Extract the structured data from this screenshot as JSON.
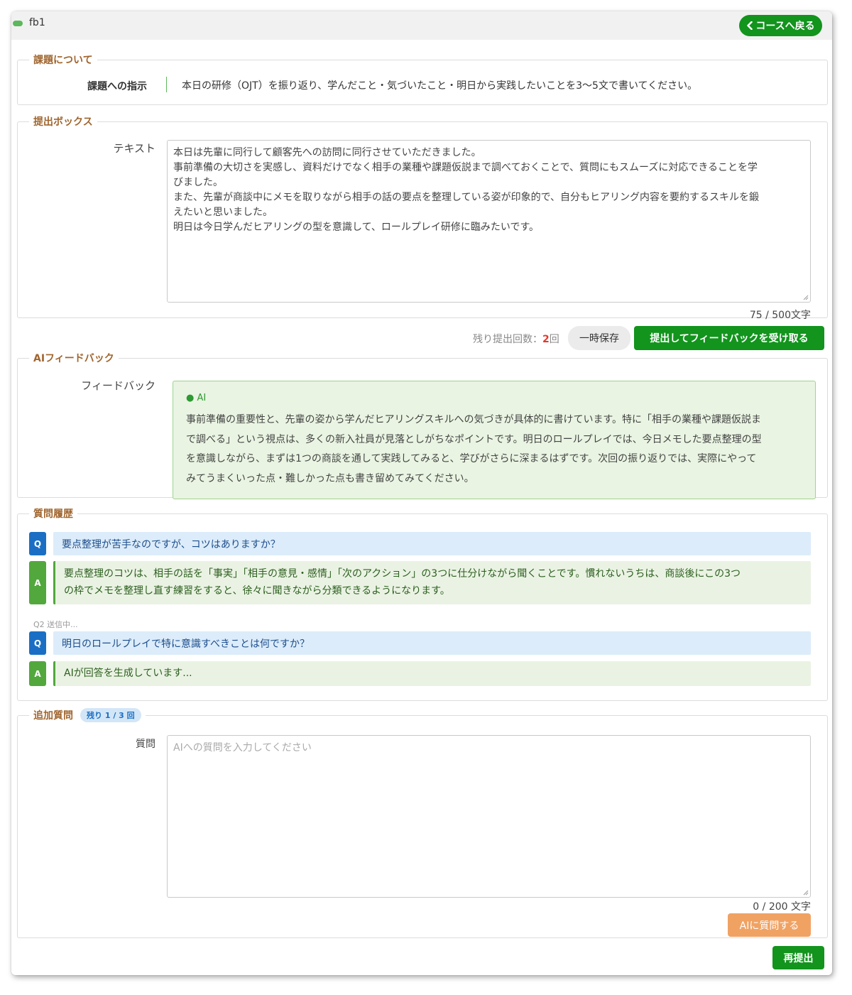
{
  "header": {
    "title": "fb1",
    "back_button": "コースへ戻る"
  },
  "assignment": {
    "legend": "課題について",
    "instruction_label": "課題への指示",
    "instruction_text": "本日の研修（OJT）を振り返り、学んだこと・気づいたこと・明日から実践したいことを3〜5文で書いてください。"
  },
  "submission": {
    "legend": "提出ボックス",
    "text_label": "テキスト",
    "lines": [
      "本日は先輩に同行して顧客先への訪問に同行させていただきました。",
      "事前準備の大切さを実感し、資料だけでなく相手の業種や課題仮説まで調べておくことで、質問にもスムーズに対応できることを学",
      "びました。",
      "また、先輩が商談中にメモを取りながら相手の話の要点を整理している姿が印象的で、自分もヒアリング内容を要約するスキルを鍛",
      "えたいと思いました。",
      "明日は今日学んだヒアリングの型を意識して、ロールプレイ研修に臨みたいです。"
    ],
    "char_count": "75 / 500文字"
  },
  "actions": {
    "remaining_label": "残り提出回数：",
    "remaining_count": "2",
    "remaining_unit": "回",
    "save_draft": "一時保存",
    "submit": "提出してフィードバックを受け取る"
  },
  "ai_feedback": {
    "legend": "AIフィードバック",
    "label": "フィードバック",
    "source_tag": "AI",
    "lines": [
      "事前準備の重要性と、先輩の姿から学んだヒアリングスキルへの気づきが具体的に書けています。特に「相手の業種や課題仮説ま",
      "で調べる」という視点は、多くの新入社員が見落としがちなポイントです。明日のロールプレイでは、今日メモした要点整理の型",
      "を意識しながら、まずは1つの商談を通して実践してみると、学びがさらに深まるはずです。次回の振り返りでは、実際にやって",
      "みてうまくいった点・難しかった点も書き留めてみてください。"
    ]
  },
  "history": {
    "legend": "質問履歴",
    "q_badge": "Q",
    "a_badge": "A",
    "q1": "要点整理が苦手なのですが、コツはありますか？",
    "a1_lines": [
      "要点整理のコツは、相手の話を「事実」「相手の意見・感情」「次のアクション」の3つに仕分けながら聞くことです。慣れないうちは、商談後にこの3つ",
      "の枠でメモを整理し直す練習をすると、徐々に聞きながら分類できるようになります。"
    ],
    "pending_label": "Q2  送信中...",
    "q2": "明日のロールプレイで特に意識すべきことは何ですか？",
    "a2": "AIが回答を生成しています..."
  },
  "followup": {
    "legend": "追加質問",
    "remaining_badge": "残り 1 / 3 回",
    "label": "質問",
    "placeholder": "AIへの質問を入力してください",
    "char_count": "0 / 200 文字",
    "ask_button": "AIに質問する"
  },
  "resubmit_button": "再提出"
}
